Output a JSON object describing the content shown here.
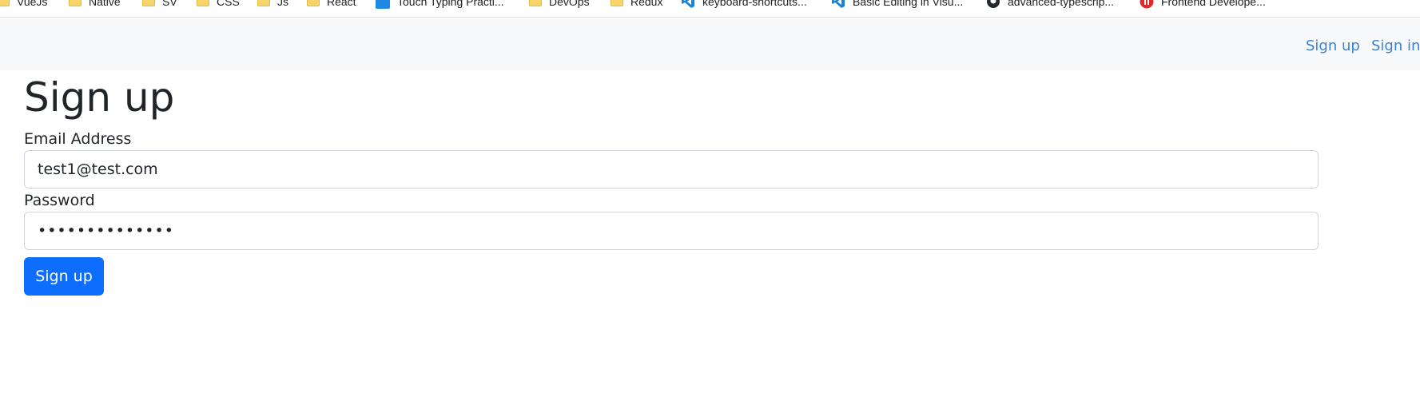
{
  "bookmarks": [
    {
      "label": "VueJs",
      "icon": "folder-icon"
    },
    {
      "label": "Native",
      "icon": "folder-icon"
    },
    {
      "label": "SV",
      "icon": "folder-icon"
    },
    {
      "label": "CSS",
      "icon": "folder-icon"
    },
    {
      "label": "Js",
      "icon": "folder-icon"
    },
    {
      "label": "React",
      "icon": "folder-icon"
    },
    {
      "label": "Touch Typing Practi...",
      "icon": "typescript-icon"
    },
    {
      "label": "DevOps",
      "icon": "folder-icon"
    },
    {
      "label": "Redux",
      "icon": "folder-icon"
    },
    {
      "label": "keyboard-shortcuts...",
      "icon": "vscode-icon"
    },
    {
      "label": "Basic Editing in Visu...",
      "icon": "vscode-icon"
    },
    {
      "label": "advanced-typescrip...",
      "icon": "github-icon"
    },
    {
      "label": "Frontend Develope...",
      "icon": "frontend-icon"
    }
  ],
  "navbar": {
    "signup_label": "Sign up",
    "signin_label": "Sign in",
    "background": "#f8f9fa",
    "link_color": "#3b82d6"
  },
  "page": {
    "title": "Sign up"
  },
  "form": {
    "email_label": "Email Address",
    "email_value": "test1@test.com",
    "password_label": "Password",
    "password_value": "••••••••••••••",
    "submit_label": "Sign up",
    "submit_color": "#0d6efd"
  }
}
